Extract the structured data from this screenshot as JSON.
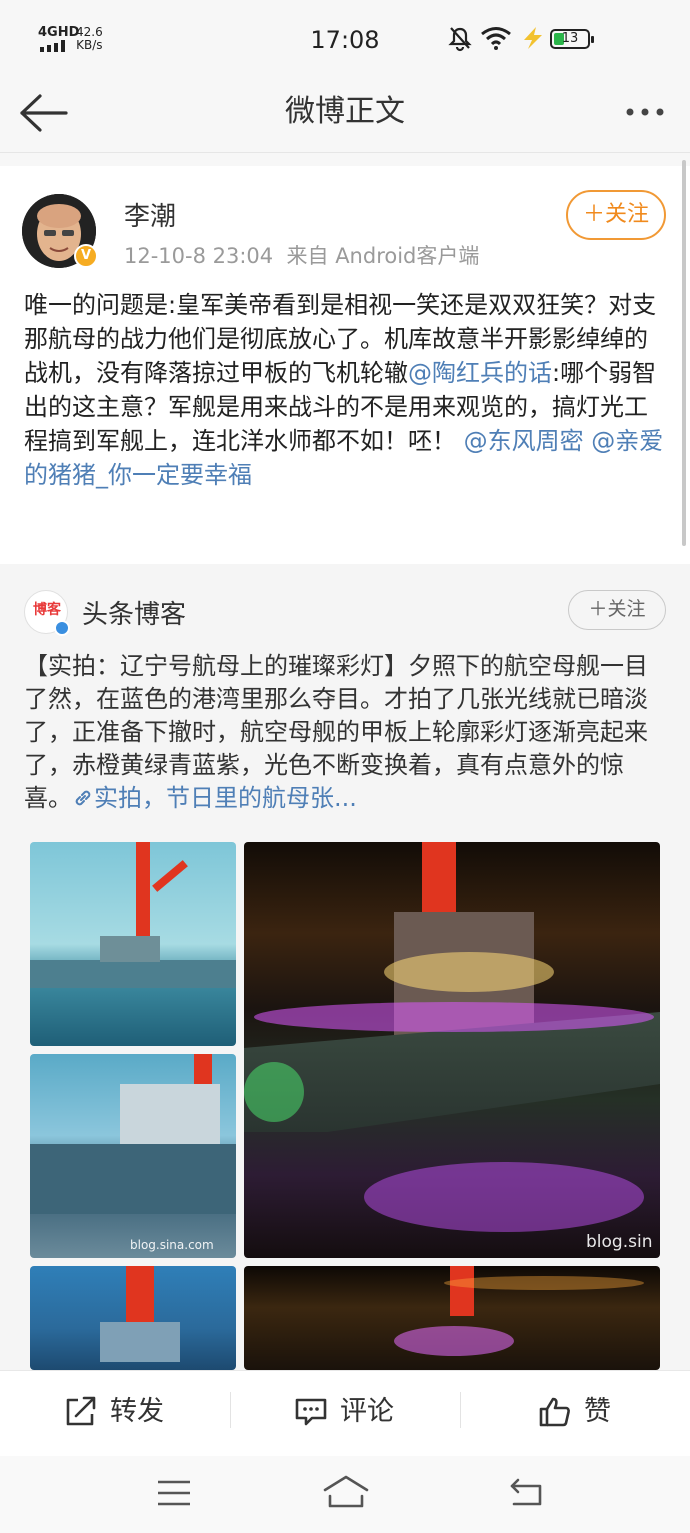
{
  "status_bar": {
    "network": "4GHD",
    "speed_value": "42.6",
    "speed_unit": "KB/s",
    "time": "17:08",
    "battery": "13",
    "icons": [
      "signal-icon",
      "mute-icon",
      "wifi-icon",
      "charging-icon",
      "battery-icon"
    ]
  },
  "nav": {
    "title": "微博正文",
    "icons": [
      "back-arrow-icon",
      "more-icon"
    ]
  },
  "post": {
    "author": "李潮",
    "timestamp": "12-10-8 23:04",
    "source": "来自 Android客户端",
    "follow_label": "＋关注",
    "text_before": "唯一的问题是:皇军美帝看到是相视一笑还是双双狂笑？对支那航母的战力他们是彻底放心了。机库故意半开影影绰绰的战机，没有降落掠过甲板的飞机轮辙",
    "mention_1": "@陶红兵的话",
    "text_middle": ":哪个弱智出的这主意？军舰是用来战斗的不是用来观览的，搞灯光工程搞到军舰上，连北洋水师都不如！呸！",
    "mention_2": "@东风周密",
    "mention_3": "@亲爱的猪猪_你一定要幸福",
    "accent_color": "#f08a1d",
    "link_color": "#4f7fb6"
  },
  "repost": {
    "avatar_text": "博客",
    "author": "头条博客",
    "follow_label": "＋关注",
    "text": "【实拍：辽宁号航母上的璀璨彩灯】夕照下的航空母舰一目了然，在蓝色的港湾里那么夺目。才拍了几张光线就已暗淡了，正准备下撤时，航空母舰的甲板上轮廓彩灯逐渐亮起来了，赤橙黄绿青蓝紫，光色不断变换着，真有点意外的惊喜。",
    "link_text": "实拍，节日里的航母张...",
    "watermark_small": "blog.sina.com",
    "watermark_large": "blog.sin"
  },
  "actions": {
    "repost_label": "转发",
    "comment_label": "评论",
    "like_label": "赞"
  }
}
